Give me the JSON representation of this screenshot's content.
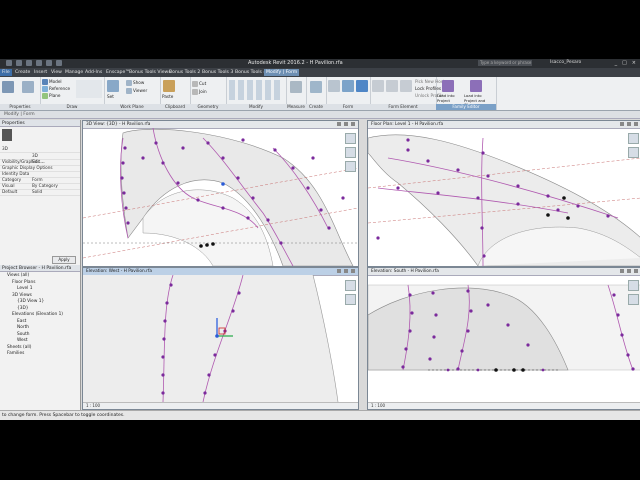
{
  "window": {
    "title": "Autodesk Revit 2016.2 -   H Pavilion.rfa",
    "search_placeholder": "Type a keyword or phrase",
    "user": "Isacco_Pesaro",
    "controls": [
      "_",
      "□",
      "×"
    ]
  },
  "ribbon_tabs": [
    {
      "label": "File",
      "active": false
    },
    {
      "label": "Create",
      "active": false
    },
    {
      "label": "Insert",
      "active": false
    },
    {
      "label": "View",
      "active": false
    },
    {
      "label": "Manage",
      "active": false
    },
    {
      "label": "Add-Ins",
      "active": false
    },
    {
      "label": "Enscape™",
      "active": false
    },
    {
      "label": "Bonus Tools Views",
      "active": false
    },
    {
      "label": "Bonus Tools 2",
      "active": false
    },
    {
      "label": "Bonus Tools 3",
      "active": false
    },
    {
      "label": "Bonus Tools 4",
      "active": false
    },
    {
      "label": "Modify | Form",
      "active": true
    }
  ],
  "ribbon_groups": {
    "properties": "Properties",
    "draw": "Draw",
    "work_plane": "Work Plane",
    "clipboard": "Clipboard",
    "geometry": "Geometry",
    "modify": "Modify",
    "measure": "Measure",
    "create": "Create",
    "form": "Form",
    "form_element": "Form Element",
    "family_editor": "Family Editor"
  },
  "ribbon_buttons": {
    "model": "Model",
    "reference": "Reference",
    "plane": "Plane",
    "set": "Set",
    "show": "Show",
    "viewer": "Viewer",
    "paste": "Paste",
    "cut": "Cut",
    "join": "Join",
    "edit_profile": "Edit Profile",
    "create_form": "Create Form",
    "xray": "X-Ray",
    "add_edge": "Add Edge",
    "add_profile": "Add Profile",
    "dissolve": "Dissolve",
    "pick_new_host": "Pick New Host",
    "lock_profiles": "Lock Profiles",
    "unlock_profile": "Unlock Profile",
    "load_into_project": "Load into Project",
    "load_into_project_close": "Load into Project and Close"
  },
  "options_bar": "Modify | Form",
  "left_panel": {
    "properties_title": "Properties",
    "type": "3D",
    "rows": [
      {
        "k": "",
        "v": "3D"
      },
      {
        "k": "Visibility/Graphics ...",
        "v": "Edit..."
      },
      {
        "k": "Graphic Display Options",
        "v": ""
      },
      {
        "k": "Identity Data",
        "v": ""
      },
      {
        "k": "Category",
        "v": "Form"
      },
      {
        "k": "Visual",
        "v": "By Category"
      },
      {
        "k": "Default",
        "v": "Solid"
      }
    ],
    "apply": "Apply",
    "browser_title": "Project Browser - H Pavilion.rfa",
    "tree": [
      {
        "t": "Views (all)",
        "indent": 1
      },
      {
        "t": "Floor Plans",
        "indent": 2
      },
      {
        "t": "Level 1",
        "indent": 3
      },
      {
        "t": "3D Views",
        "indent": 2
      },
      {
        "t": "{3D View 1}",
        "indent": 3
      },
      {
        "t": "{3D}",
        "indent": 3
      },
      {
        "t": "Elevations (Elevation 1)",
        "indent": 2
      },
      {
        "t": "East",
        "indent": 3
      },
      {
        "t": "North",
        "indent": 3
      },
      {
        "t": "South",
        "indent": 3
      },
      {
        "t": "West",
        "indent": 3
      },
      {
        "t": "Sheets (all)",
        "indent": 1
      },
      {
        "t": "Families",
        "indent": 1
      }
    ]
  },
  "views": [
    {
      "title": "3D View: {3D} - H Pavilion.rfa",
      "scale": ""
    },
    {
      "title": "Floor Plan: Level 1 - H Pavilion.rfa",
      "scale": ""
    },
    {
      "title": "Elevation: West - H Pavilion.rfa",
      "scale": "1 : 100"
    },
    {
      "title": "Elevation: South - H Pavilion.rfa",
      "scale": "1 : 100"
    }
  ],
  "status": "to change form. Press Spacebar to toggle coordinates.",
  "colors": {
    "active_tab": "#6d8fb3",
    "point": "#7b2a9c",
    "profile_line": "#b05ab0",
    "ref_line": "#c87070"
  }
}
